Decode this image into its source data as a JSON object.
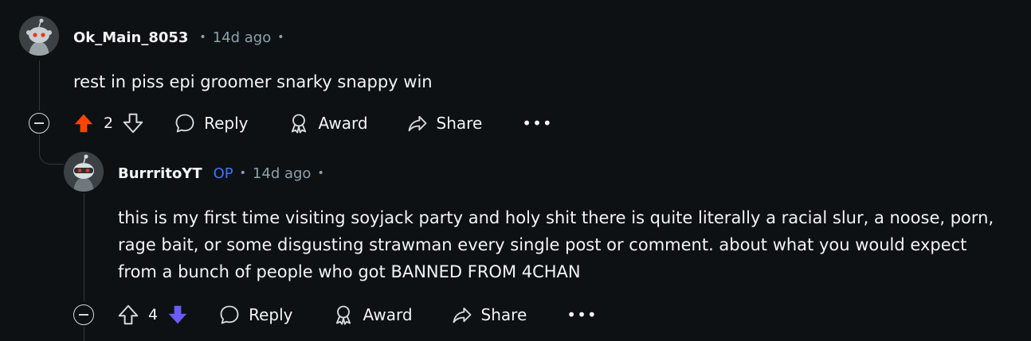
{
  "comments": [
    {
      "username": "Ok_Main_8053",
      "time": "14d ago",
      "body": "rest in piss epi groomer snarky snappy win",
      "score": "2",
      "vote_state": "upvoted",
      "actions": {
        "reply": "Reply",
        "award": "Award",
        "share": "Share",
        "more": "•••"
      }
    },
    {
      "username": "BurrritoYT",
      "badge": "OP",
      "time": "14d ago",
      "body": "this is my first time visiting soyjack party and holy shit there is quite literally a racial slur, a noose, porn,\nrage bait, or some disgusting strawman every single post or comment. about what you would expect\nfrom a bunch of people who got BANNED FROM 4CHAN",
      "score": "4",
      "vote_state": "downvoted",
      "actions": {
        "reply": "Reply",
        "award": "Award",
        "share": "Share",
        "more": "•••"
      }
    }
  ],
  "colors": {
    "background": "#0e1113",
    "upvote": "#ff4500",
    "downvote": "#6a5cff",
    "op_badge": "#3f74f9",
    "meta_text": "#8ba2ad"
  },
  "icons": [
    "upvote-icon",
    "downvote-icon",
    "comment-icon",
    "award-icon",
    "share-icon",
    "collapse-icon",
    "more-icon"
  ]
}
